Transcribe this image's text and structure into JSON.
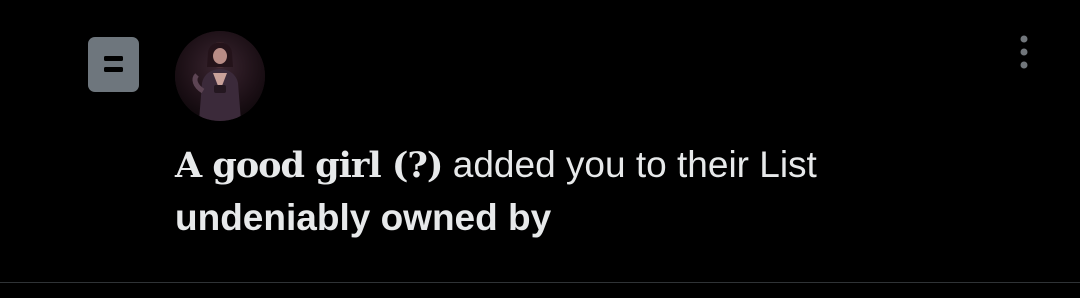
{
  "notification": {
    "type_icon": "list-icon",
    "avatar_icon": "user-avatar",
    "more_icon": "more-vertical-icon",
    "actor_name": "A good girl (?)",
    "action_text": " added you to their List",
    "list_name": "undeniably owned by"
  },
  "colors": {
    "background": "#000000",
    "text": "#e7e9ea",
    "icon_badge": "#6e767d",
    "more_icon": "#71767b",
    "divider": "#2f3336"
  }
}
